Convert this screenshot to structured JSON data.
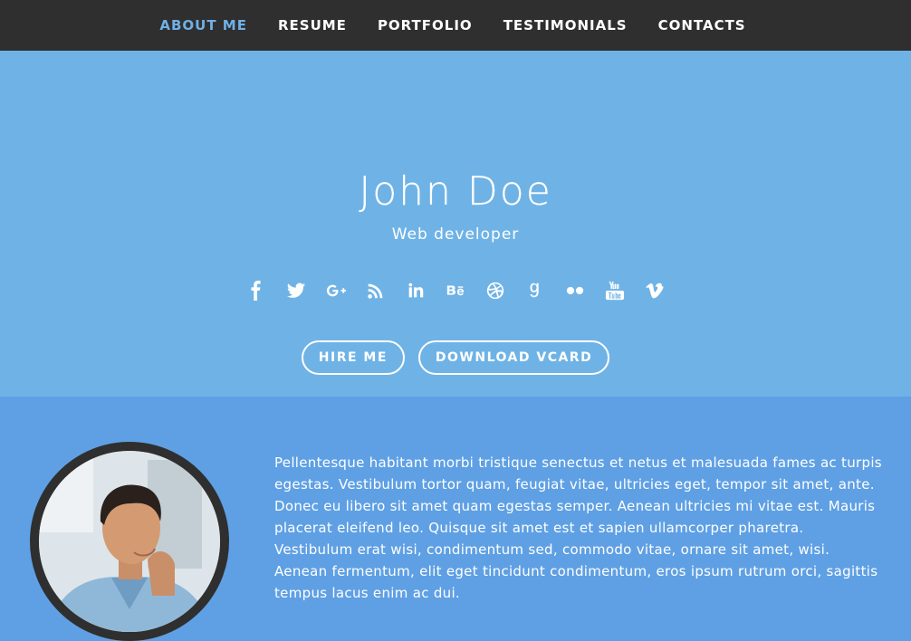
{
  "nav": {
    "items": [
      {
        "label": "ABOUT ME",
        "active": true
      },
      {
        "label": "RESUME",
        "active": false
      },
      {
        "label": "PORTFOLIO",
        "active": false
      },
      {
        "label": "TESTIMONIALS",
        "active": false
      },
      {
        "label": "CONTACTS",
        "active": false
      }
    ]
  },
  "hero": {
    "name": "John Doe",
    "role": "Web developer",
    "socials": [
      "facebook-icon",
      "twitter-icon",
      "google-plus-icon",
      "rss-icon",
      "linkedin-icon",
      "behance-icon",
      "dribbble-icon",
      "goodreads-icon",
      "flickr-icon",
      "youtube-icon",
      "vimeo-icon"
    ],
    "hire_label": "HIRE ME",
    "vcard_label": "DOWNLOAD VCARD"
  },
  "about": {
    "text": "Pellentesque habitant morbi tristique senectus et netus et malesuada fames ac turpis egestas. Vestibulum tortor quam, feugiat vitae, ultricies eget, tempor sit amet, ante. Donec eu libero sit amet quam egestas semper. Aenean ultricies mi vitae est. Mauris placerat eleifend leo. Quisque sit amet est et sapien ullamcorper pharetra. Vestibulum erat wisi, condimentum sed, commodo vitae, ornare sit amet, wisi. Aenean fermentum, elit eget tincidunt condimentum, eros ipsum rutrum orci, sagittis tempus lacus enim ac dui."
  },
  "colors": {
    "nav_bg": "#2f2f2f",
    "nav_active": "#6fb0e6",
    "hero_bg": "#6fb3e6",
    "about_bg": "#5fa0e4"
  }
}
